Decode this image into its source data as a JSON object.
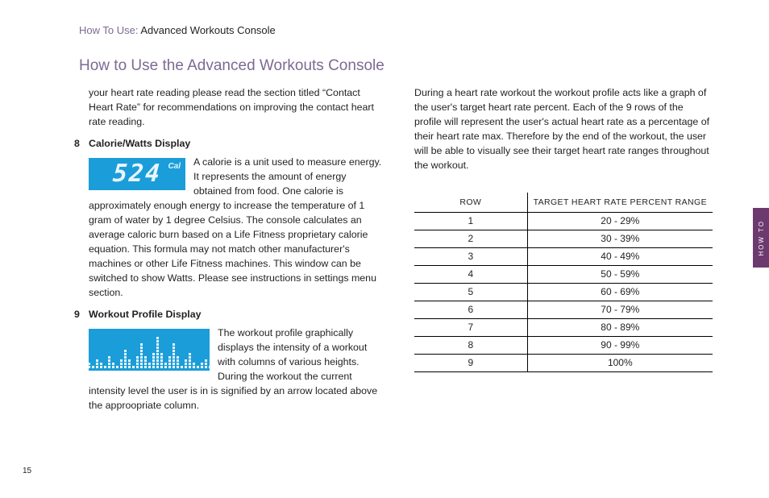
{
  "header": {
    "prefix": "How To Use: ",
    "suffix": "Advanced Workouts Console"
  },
  "title": "How to Use the Advanced Workouts Console",
  "left": {
    "intro": "your heart rate reading please read the section titled “Contact Heart Rate” for recommendations on improving the contact heart rate reading.",
    "s8": {
      "num": "8",
      "title": "Calorie/Watts Display",
      "digits": "524",
      "unit": "Cal",
      "body": "A calorie is a unit used to measure energy. It represents the amount of energy obtained from food. One calorie is approximately enough energy to increase the temperature of 1 gram of water by 1 degree Celsius. The console calculates an average caloric burn based on a Life Fitness proprietary calorie equation. This formula may not match other manufacturer's machines or other Life Fitness machines.  This window can be switched to show Watts. Please see instructions in settings menu section."
    },
    "s9": {
      "num": "9",
      "title": "Workout Profile Display",
      "body": "The workout profile graphically displays the intensity of a workout with columns of various heights. During the workout the current intensity level the user is in is signified by an arrow located above the approopriate column."
    }
  },
  "right": {
    "intro": "During a heart rate workout the workout profile acts like a graph of the user's target heart rate percent. Each of the 9 rows of the profile will represent the user's actual heart rate as a percentage of their heart rate max. Therefore by the end of the workout, the user will be able to visually see their target heart rate ranges throughout the workout.",
    "table": {
      "head_row": "ROW",
      "head_range": "TARGET HEART RATE PERCENT RANGE",
      "rows": [
        {
          "row": "1",
          "range": "20 - 29%"
        },
        {
          "row": "2",
          "range": "30 - 39%"
        },
        {
          "row": "3",
          "range": "40 - 49%"
        },
        {
          "row": "4",
          "range": "50 - 59%"
        },
        {
          "row": "5",
          "range": "60 - 69%"
        },
        {
          "row": "6",
          "range": "70 - 79%"
        },
        {
          "row": "7",
          "range": "80 - 89%"
        },
        {
          "row": "8",
          "range": "90 - 99%"
        },
        {
          "row": "9",
          "range": "100%"
        }
      ]
    }
  },
  "page_number": "15",
  "side_tab": "HOW TO",
  "profile_bars": [
    2,
    1,
    3,
    2,
    1,
    4,
    2,
    1,
    3,
    6,
    3,
    1,
    4,
    8,
    4,
    2,
    5,
    10,
    5,
    2,
    4,
    8,
    4,
    1,
    3,
    5,
    2,
    1,
    2,
    3,
    1
  ]
}
